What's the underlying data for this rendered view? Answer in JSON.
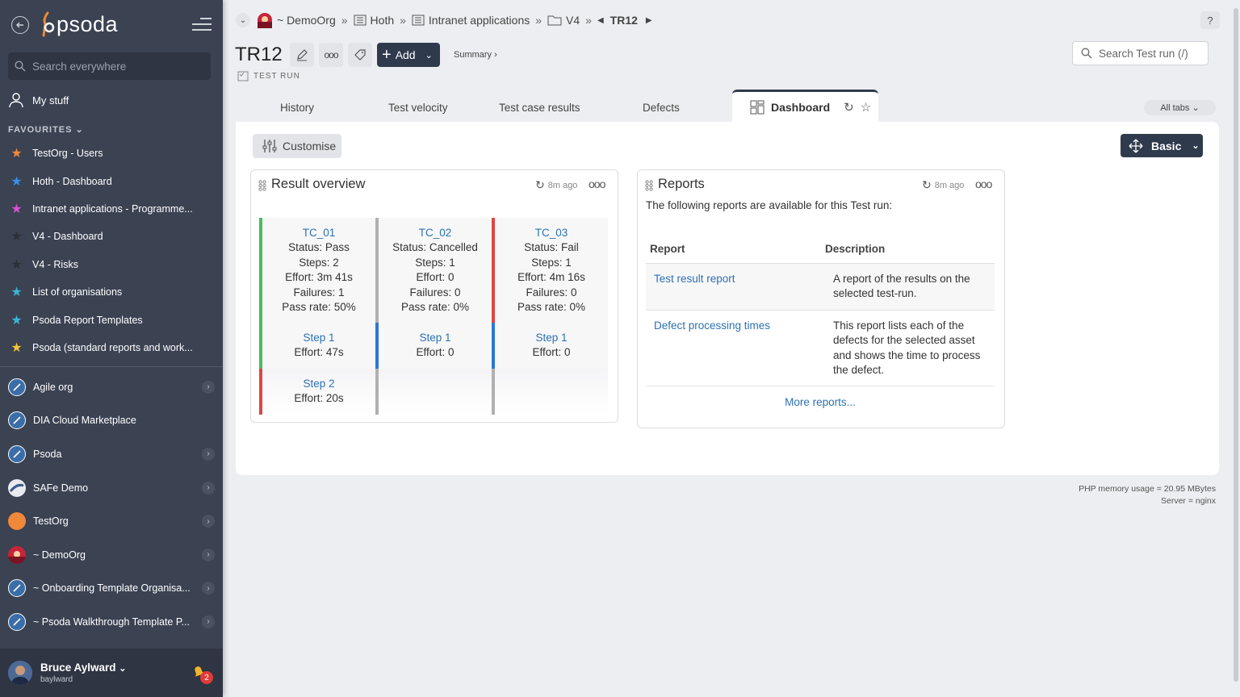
{
  "app": {
    "logo_text": "psoda",
    "accent_color": "#2f3a4d",
    "sidebar_color": "#3b4252"
  },
  "sidebar": {
    "search_placeholder": "Search everywhere",
    "my_stuff": "My stuff",
    "favourites_heading": "FAVOURITES",
    "favourites": [
      {
        "label": "TestOrg - Users",
        "star_color": "#f0883a"
      },
      {
        "label": "Hoth - Dashboard",
        "star_color": "#3a8ee6"
      },
      {
        "label": "Intranet applications - Programme...",
        "star_color": "#d94fd0"
      },
      {
        "label": "V4 - Dashboard",
        "star_color": "#2b2f38"
      },
      {
        "label": "V4 - Risks",
        "star_color": "#2b2f38"
      },
      {
        "label": "List of organisations",
        "star_color": "#3ab4d6"
      },
      {
        "label": "Psoda Report Templates",
        "star_color": "#3ab4d6"
      },
      {
        "label": "Psoda (standard reports and work...",
        "star_color": "#f0c53a"
      }
    ],
    "orgs": [
      {
        "label": "Agile org",
        "has_children": true,
        "icon": "rocket-icon"
      },
      {
        "label": "DIA Cloud Marketplace",
        "has_children": false,
        "icon": "rocket-icon"
      },
      {
        "label": "Psoda",
        "has_children": true,
        "icon": "rocket-icon"
      },
      {
        "label": "SAFe Demo",
        "has_children": true,
        "icon": "safe-logo-icon"
      },
      {
        "label": "TestOrg",
        "has_children": true,
        "icon": "orange-circle-icon"
      },
      {
        "label": "~ DemoOrg",
        "has_children": true,
        "icon": "sunset-icon"
      },
      {
        "label": "~ Onboarding Template Organisa...",
        "has_children": true,
        "icon": "rocket-icon"
      },
      {
        "label": "~ Psoda Walkthrough Template P...",
        "has_children": true,
        "icon": "rocket-icon"
      }
    ],
    "user": {
      "name": "Bruce Aylward",
      "username": "baylward",
      "notification_count": "2"
    }
  },
  "breadcrumb": {
    "items": [
      "~ DemoOrg",
      "Hoth",
      "Intranet applications",
      "V4",
      "TR12"
    ]
  },
  "header": {
    "title": "TR12",
    "subtitle": "TEST RUN",
    "add_label": "Add",
    "summary_label": "Summary ›",
    "search_placeholder": "Search Test run (/)",
    "help_label": "?"
  },
  "tabs": {
    "items": [
      "History",
      "Test velocity",
      "Test case results",
      "Defects"
    ],
    "active": "Dashboard",
    "all_tabs": "All tabs"
  },
  "toolbar": {
    "customise": "Customise",
    "layout": "Basic"
  },
  "result_overview": {
    "title": "Result overview",
    "refreshed": "8m ago",
    "cases": [
      {
        "name": "TC_01",
        "status": "Status: Pass",
        "steps": "Steps: 2",
        "effort": "Effort: 3m 41s",
        "failures": "Failures: 1",
        "pass_rate": "Pass rate: 50%",
        "color": "#4cbb5f",
        "step_rows": [
          {
            "name": "Step 1",
            "effort": "Effort: 47s",
            "color": "#4cbb5f"
          },
          {
            "name": "Step 2",
            "effort": "Effort: 20s",
            "color": "#e04545"
          }
        ]
      },
      {
        "name": "TC_02",
        "status": "Status: Cancelled",
        "steps": "Steps: 1",
        "effort": "Effort: 0",
        "failures": "Failures: 0",
        "pass_rate": "Pass rate: 0%",
        "color": "#b0b0b0",
        "step_rows": [
          {
            "name": "Step 1",
            "effort": "Effort: 0",
            "color": "#2c78d6"
          }
        ]
      },
      {
        "name": "TC_03",
        "status": "Status: Fail",
        "steps": "Steps: 1",
        "effort": "Effort: 4m 16s",
        "failures": "Failures: 0",
        "pass_rate": "Pass rate: 0%",
        "color": "#e04545",
        "step_rows": [
          {
            "name": "Step 1",
            "effort": "Effort: 0",
            "color": "#2c78d6"
          }
        ]
      }
    ]
  },
  "reports": {
    "title": "Reports",
    "refreshed": "8m ago",
    "intro": "The following reports are available for this Test run:",
    "col_report": "Report",
    "col_description": "Description",
    "rows": [
      {
        "report": "Test result report",
        "description": "A report of the results on the selected test-run."
      },
      {
        "report": "Defect processing times",
        "description": "This report lists each of the defects for the selected asset and shows the time to process the defect."
      }
    ],
    "more": "More reports..."
  },
  "footer": {
    "memory": "PHP memory usage = 20.95 MBytes",
    "server": "Server = nginx"
  }
}
